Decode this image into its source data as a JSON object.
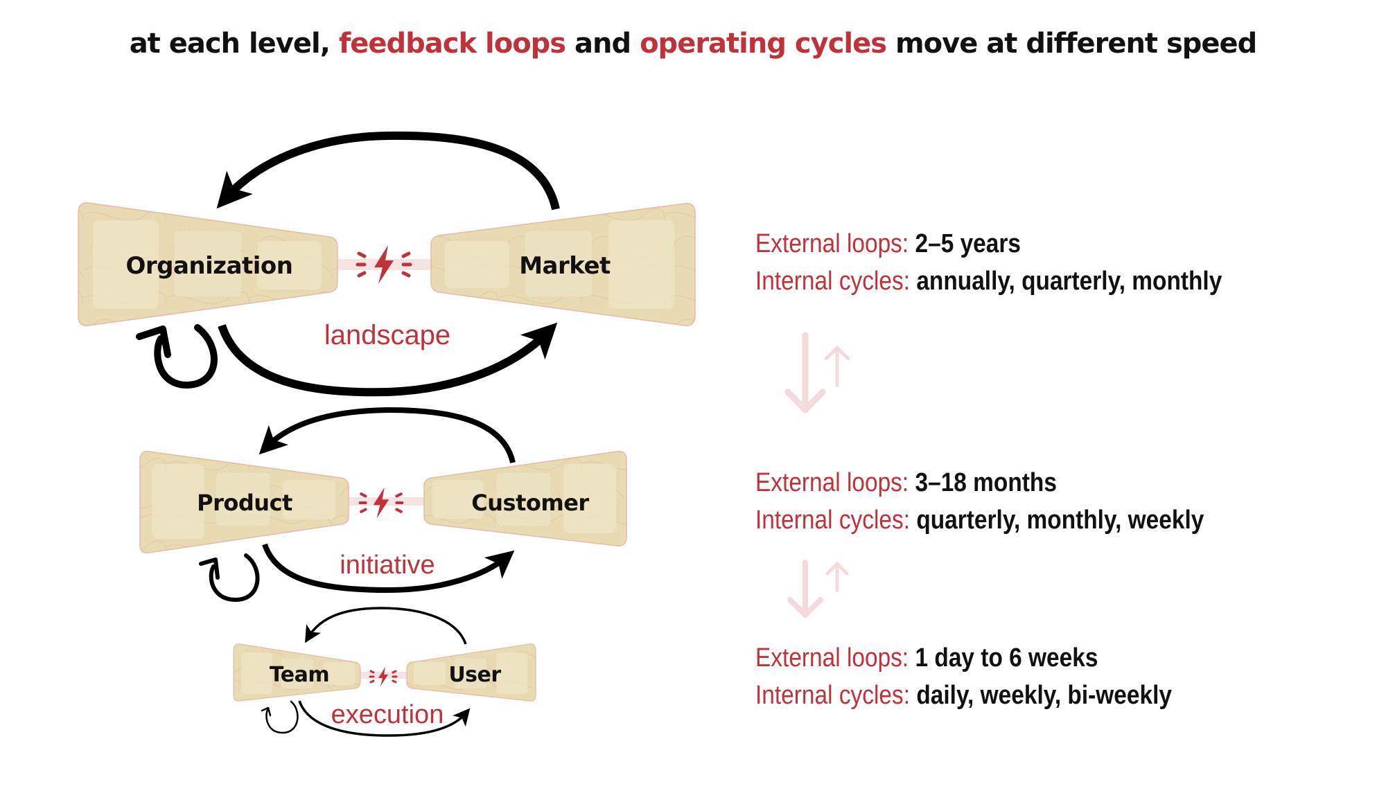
{
  "title": {
    "part1": "at each level, ",
    "part2": "feedback loops",
    "part3": " and ",
    "part4": "operating cycles",
    "part5": " move at different speed"
  },
  "colors": {
    "accent": "#c0323a",
    "tile_fill": "#e8dbb4",
    "tile_panel": "#ede3c4",
    "tile_stroke": "#e7b9a6",
    "connector": "#f6e4e4",
    "level_arrows": "#f4dada",
    "text": "#111111"
  },
  "levels": [
    {
      "id": "landscape",
      "label": "landscape",
      "left_tile": "Organization",
      "right_tile": "Market",
      "external_key": "External loops:",
      "external_value": "2–5 years",
      "internal_key": "Internal cycles:",
      "internal_value": "annually, quarterly, monthly"
    },
    {
      "id": "initiative",
      "label": "initiative",
      "left_tile": "Product",
      "right_tile": "Customer",
      "external_key": "External loops:",
      "external_value": "3–18 months",
      "internal_key": "Internal cycles:",
      "internal_value": "quarterly, monthly, weekly"
    },
    {
      "id": "execution",
      "label": "execution",
      "left_tile": "Team",
      "right_tile": "User",
      "external_key": "External loops:",
      "external_value": "1 day to 6 weeks",
      "internal_key": "Internal cycles:",
      "internal_value": "daily, weekly, bi-weekly"
    }
  ],
  "icons": {
    "tension": "lightning-bolt-icon",
    "feedback": "curved-arrow-icon",
    "self_loop": "circular-arrow-icon",
    "level_link": "down-up-arrows-icon"
  }
}
